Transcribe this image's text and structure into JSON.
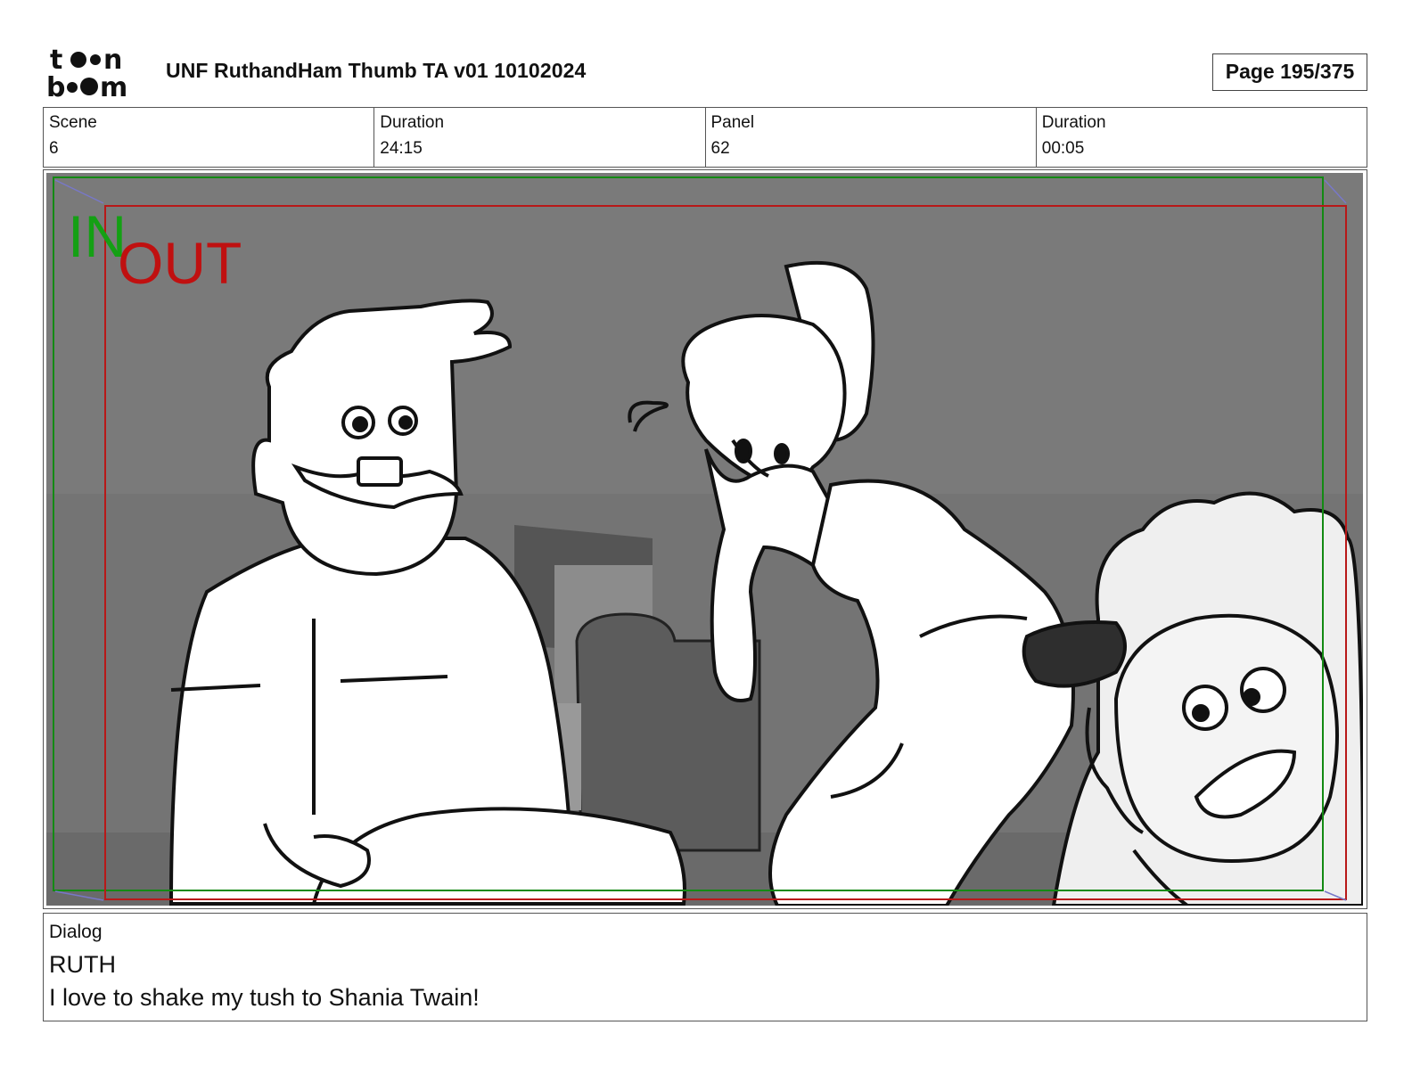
{
  "header": {
    "logo_text": "toonboom",
    "title": "UNF RuthandHam Thumb TA v01 10102024",
    "page": "Page 195/375"
  },
  "info": {
    "scene_label": "Scene",
    "scene_value": "6",
    "scene_duration_label": "Duration",
    "scene_duration_value": "24:15",
    "panel_label": "Panel",
    "panel_value": "62",
    "panel_duration_label": "Duration",
    "panel_duration_value": "00:05"
  },
  "panel": {
    "in_marker": "IN",
    "out_marker": "OUT",
    "in_color": "#14a014",
    "out_color": "#c01010",
    "background_color": "#7a7a7a"
  },
  "dialog": {
    "label": "Dialog",
    "speaker": "RUTH",
    "line": "I love to shake my tush to Shania Twain!"
  }
}
